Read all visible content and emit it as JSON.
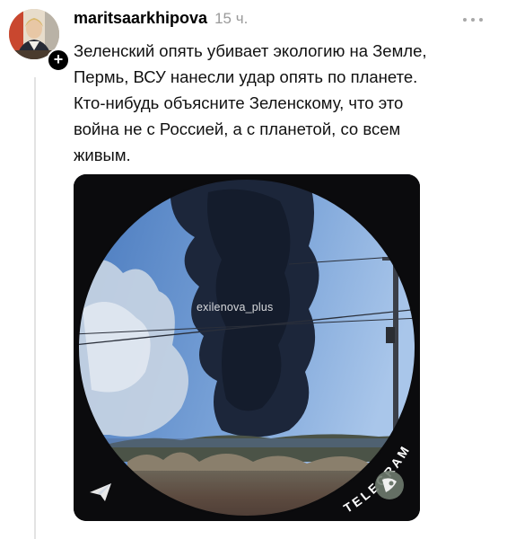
{
  "post": {
    "username": "maritsaarkhipova",
    "timestamp": "15 ч.",
    "more_icon": "more-horizontal-icon",
    "follow_icon": "plus-icon",
    "follow_symbol": "+",
    "text_lines": [
      "Зеленский опять убивает экологию на Земле,",
      "Пермь, ВСУ нанесли удар опять по планете.",
      "Кто-нибудь объясните Зеленскому, что это",
      "война  не с Россией, а с планетой, со всем",
      "живым."
    ]
  },
  "media": {
    "watermark": "exilenova_plus",
    "telegram_text": "TELEGRAM",
    "telegram_icon": "telegram-paper-plane-icon",
    "sticker_icon": "round-video-sticker-icon"
  },
  "colors": {
    "text": "#111111",
    "muted": "#9a9a9a",
    "sky": "#5f8ec9",
    "smoke": "#1b2438",
    "frame": "#0b0b0d"
  }
}
